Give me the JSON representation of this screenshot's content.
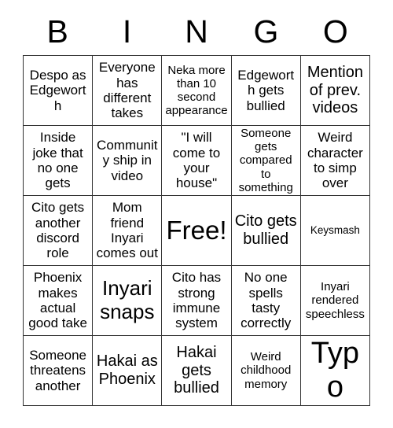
{
  "card": {
    "header_letters": [
      "B",
      "I",
      "N",
      "G",
      "O"
    ],
    "free_space_index": 12,
    "colors": {
      "background": "#ffffff",
      "text": "#000000",
      "grid_line": "#333333"
    },
    "cells": [
      {
        "text": "Despo as Edgeworth",
        "size": "fs-m"
      },
      {
        "text": "Everyone has different takes",
        "size": "fs-m"
      },
      {
        "text": "Neka more than 10 second appearance",
        "size": "fs-s"
      },
      {
        "text": "Edgeworth gets bullied",
        "size": "fs-m"
      },
      {
        "text": "Mention of prev. videos",
        "size": "fs-l"
      },
      {
        "text": "Inside joke that no one gets",
        "size": "fs-m"
      },
      {
        "text": "Community ship in video",
        "size": "fs-m"
      },
      {
        "text": "\"I will come to your house\"",
        "size": "fs-m"
      },
      {
        "text": "Someone gets compared to something",
        "size": "fs-s"
      },
      {
        "text": "Weird character to simp over",
        "size": "fs-m"
      },
      {
        "text": "Cito gets another discord role",
        "size": "fs-m"
      },
      {
        "text": "Mom friend Inyari comes out",
        "size": "fs-m"
      },
      {
        "text": "Free!",
        "size": "fs-xxl"
      },
      {
        "text": "Cito gets bullied",
        "size": "fs-l"
      },
      {
        "text": "Keysmash",
        "size": "fs-xs"
      },
      {
        "text": "Phoenix makes actual good take",
        "size": "fs-m"
      },
      {
        "text": "Inyari snaps",
        "size": "fs-xl"
      },
      {
        "text": "Cito has strong immune system",
        "size": "fs-m"
      },
      {
        "text": "No one spells tasty correctly",
        "size": "fs-m"
      },
      {
        "text": "Inyari rendered speechless",
        "size": "fs-s"
      },
      {
        "text": "Someone threatens another",
        "size": "fs-m"
      },
      {
        "text": "Hakai as Phoenix",
        "size": "fs-l"
      },
      {
        "text": "Hakai gets bullied",
        "size": "fs-l"
      },
      {
        "text": "Weird childhood memory",
        "size": "fs-s"
      },
      {
        "text": "Typo",
        "size": "fs-huge"
      }
    ]
  }
}
